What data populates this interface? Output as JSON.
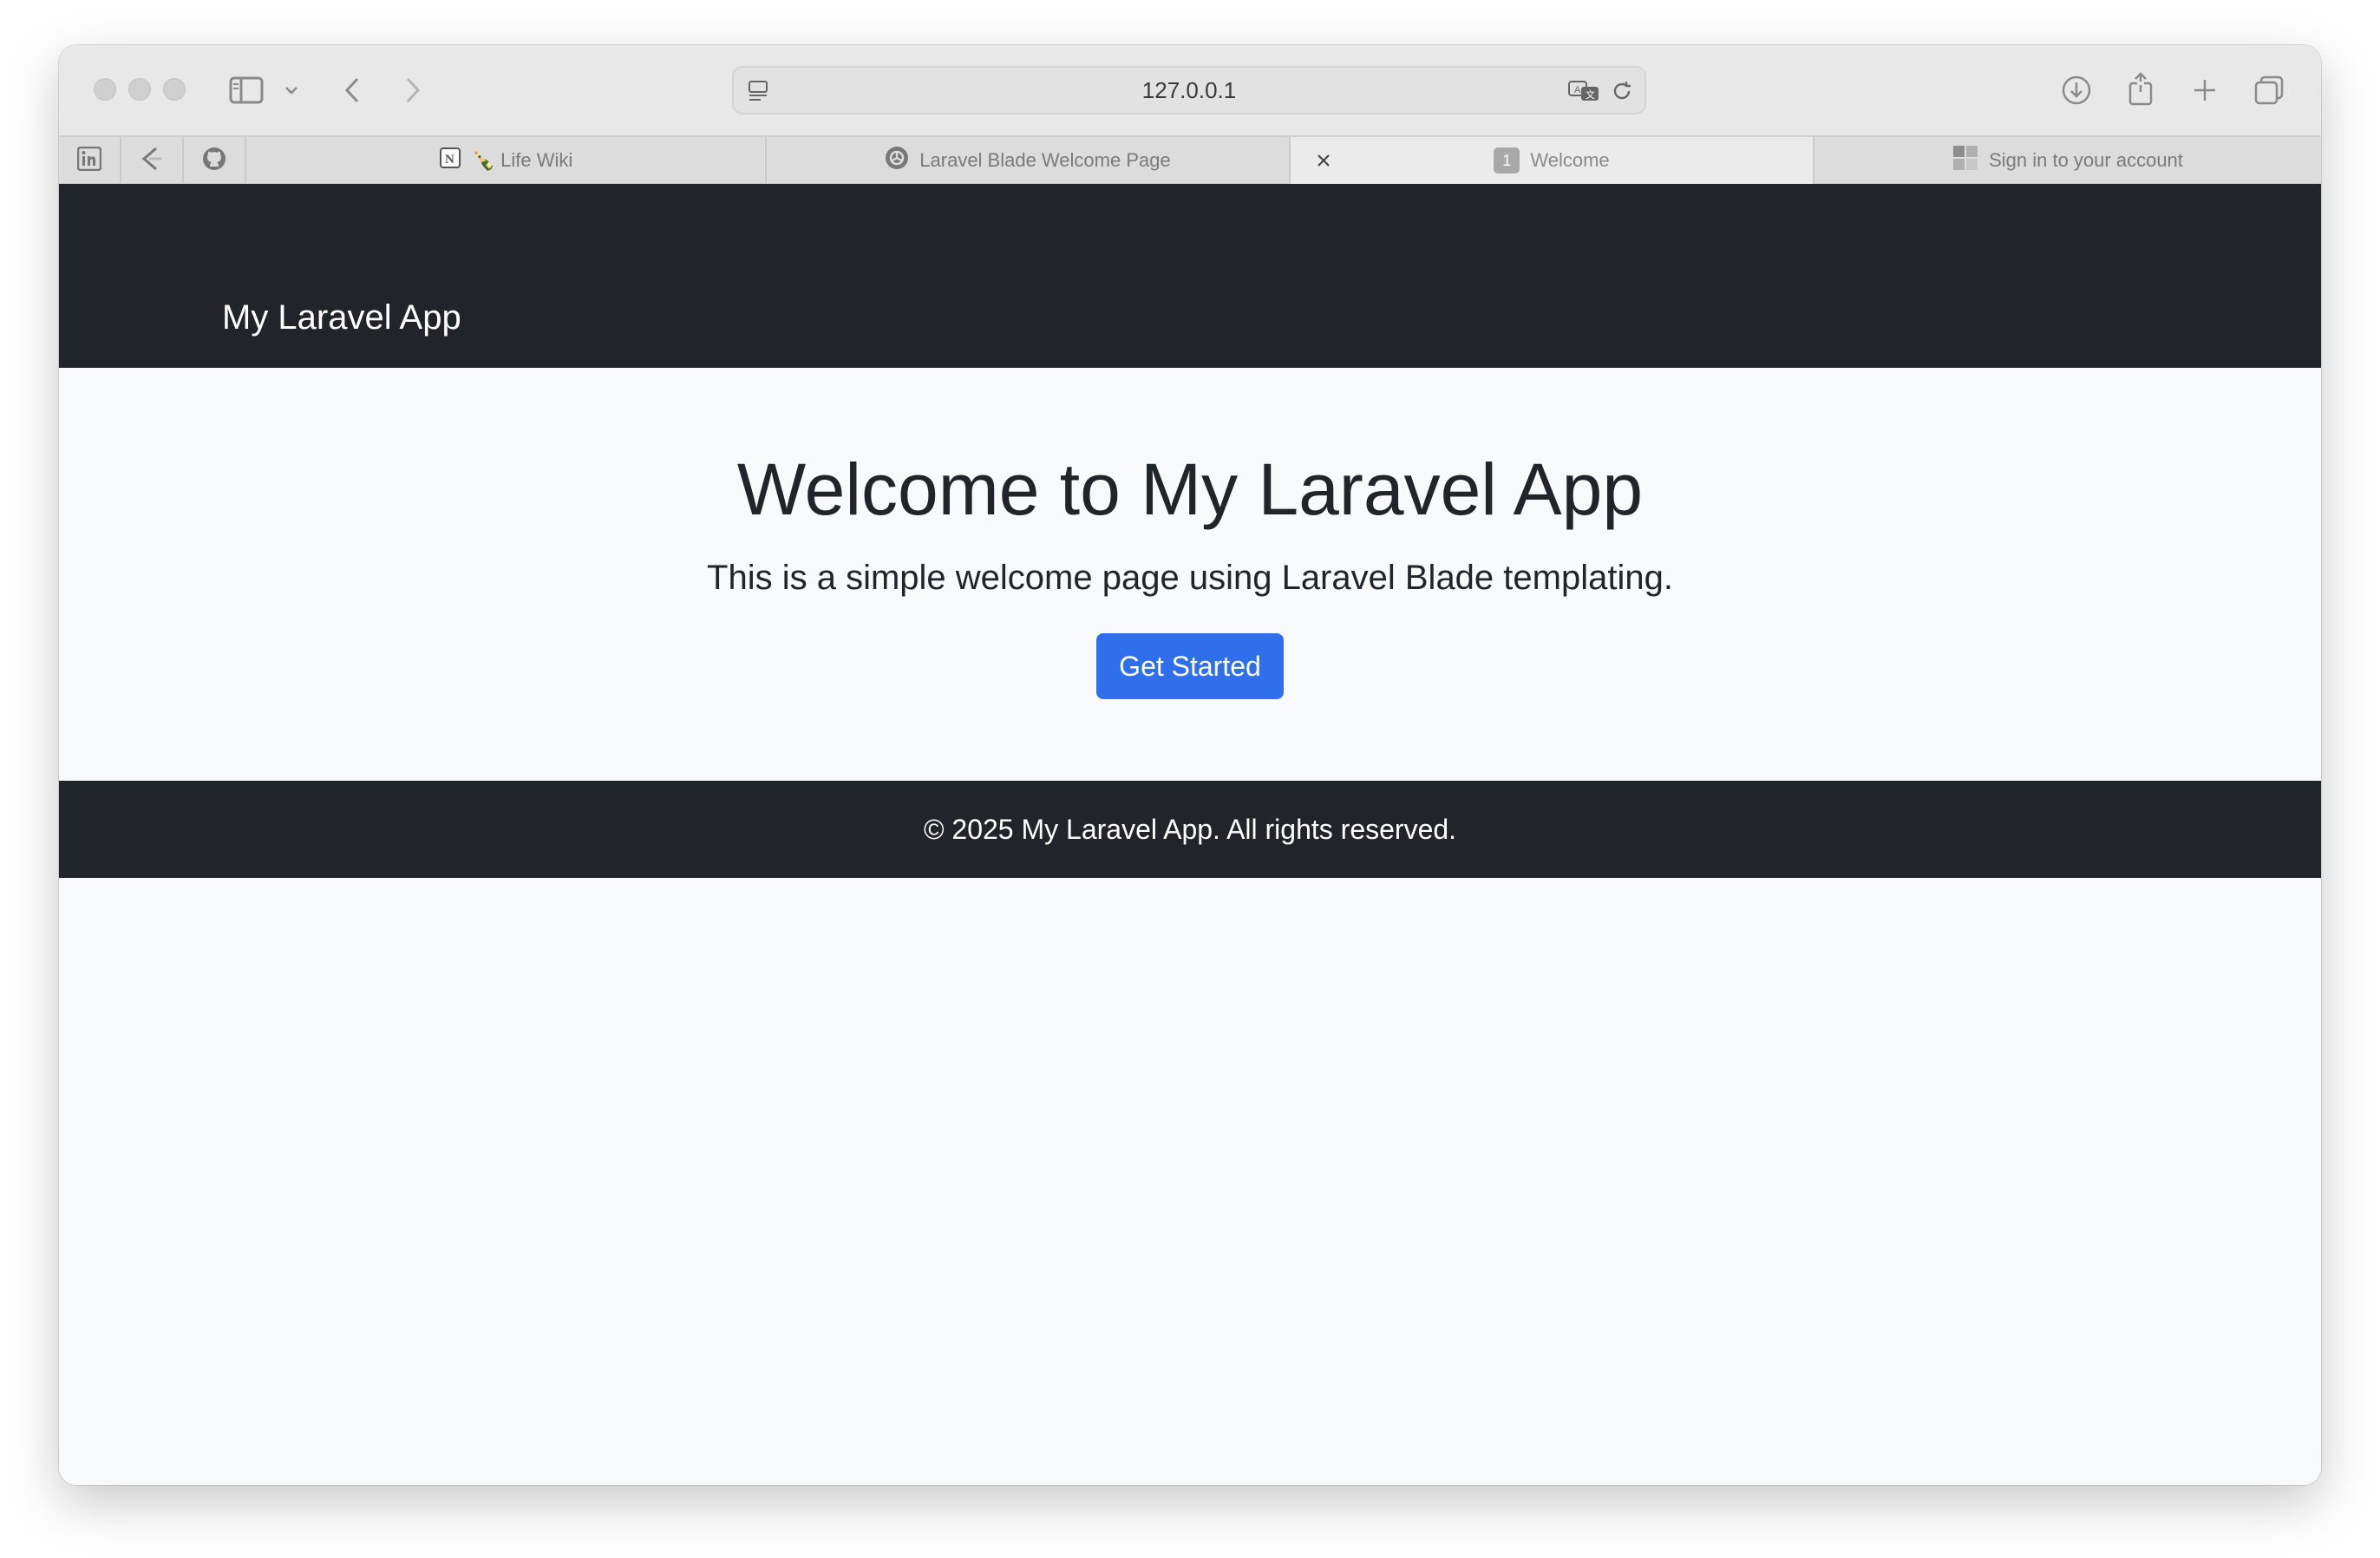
{
  "browser": {
    "url": "127.0.0.1",
    "pinned_tabs": [
      {
        "icon": "linkedin-icon"
      },
      {
        "icon": "pin-tab-icon"
      },
      {
        "icon": "github-icon"
      }
    ],
    "tabs": [
      {
        "label": "🍾 Life Wiki",
        "icon": "notion-icon"
      },
      {
        "label": "Laravel Blade Welcome Page",
        "icon": "openai-icon"
      },
      {
        "label": "Welcome",
        "icon": "tab-number-icon",
        "badge": "1",
        "active": true
      },
      {
        "label": "Sign in to your account",
        "icon": "microsoft-icon"
      }
    ]
  },
  "page": {
    "navbar": {
      "brand": "My Laravel App"
    },
    "hero": {
      "title": "Welcome to My Laravel App",
      "lead": "This is a simple welcome page using Laravel Blade templating.",
      "button_label": "Get Started"
    },
    "footer": {
      "text": "© 2025 My Laravel App. All rights reserved."
    }
  },
  "colors": {
    "navbar_bg": "#212529",
    "body_bg": "#f8f9fa",
    "primary": "#2f6fec"
  }
}
